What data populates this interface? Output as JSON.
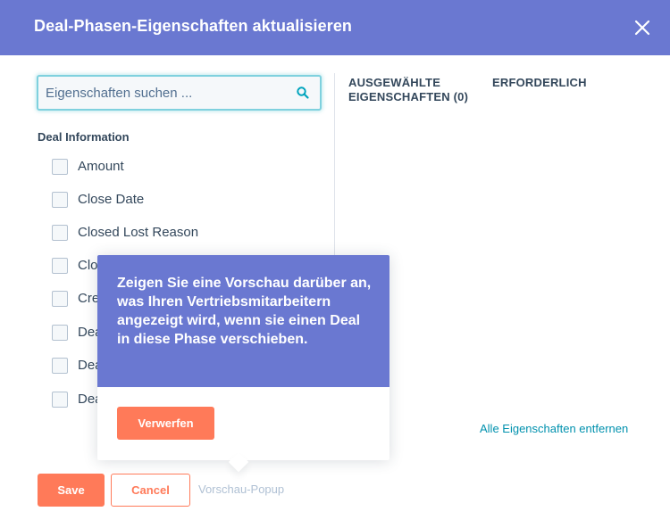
{
  "header": {
    "title": "Deal-Phasen-Eigenschaften aktualisieren",
    "close_icon": "close-icon",
    "background": "#6a78d1"
  },
  "search": {
    "placeholder": "Eigenschaften suchen ...",
    "value": "",
    "icon": "search-icon"
  },
  "section": {
    "label": "Deal Information",
    "items": [
      {
        "label": "Amount"
      },
      {
        "label": "Close Date"
      },
      {
        "label": "Closed Lost Reason"
      },
      {
        "label": "Clo"
      },
      {
        "label": "Cre"
      },
      {
        "label": "Dea"
      },
      {
        "label": "Dea"
      },
      {
        "label": "Dea"
      }
    ]
  },
  "selected": {
    "heading": "AUSGEWÄHLTE EIGENSCHAFTEN (0)",
    "required_heading": "ERFORDERLICH",
    "remove_all": "Alle Eigenschaften entfernen"
  },
  "popover": {
    "text": "Zeigen Sie eine Vorschau darüber an, was Ihren Vertriebsmitarbeitern angezeigt wird, wenn sie einen Deal in diese Phase verschieben.",
    "dismiss_label": "Verwerfen"
  },
  "footer": {
    "save_label": "Save",
    "cancel_label": "Cancel",
    "preview_label": "Vorschau-Popup"
  },
  "colors": {
    "accent": "#ff7a59",
    "header": "#6a78d1",
    "link": "#0091ae"
  }
}
